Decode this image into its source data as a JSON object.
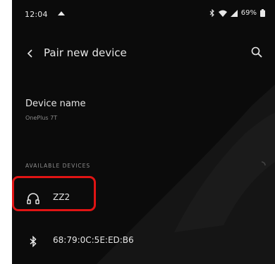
{
  "status_bar": {
    "time": "12:04",
    "notification_icon": "cloud-upload-icon",
    "bluetooth_icon": "bluetooth-icon",
    "wifi_icon": "wifi-icon",
    "signal_icon": "signal-icon",
    "battery_percent": "69%",
    "battery_icon": "battery-icon"
  },
  "app_bar": {
    "back_icon": "back-arrow-icon",
    "title": "Pair new device",
    "search_icon": "search-icon"
  },
  "device_name": {
    "label": "Device name",
    "value": "OnePlus 7T"
  },
  "available_devices": {
    "header": "AVAILABLE DEVICES",
    "items": [
      {
        "icon": "headphones-icon",
        "label": "ZZ2",
        "highlighted": true
      },
      {
        "icon": "bluetooth-icon",
        "label": "68:79:0C:5E:ED:B6",
        "highlighted": false
      }
    ]
  },
  "colors": {
    "background": "#0b0b0b",
    "text": "#e6e6e6",
    "secondary_text": "#8d8d8d",
    "highlight": "#e01414"
  }
}
